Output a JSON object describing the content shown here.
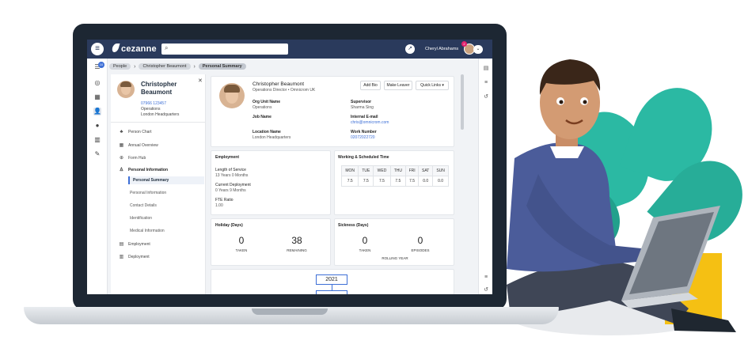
{
  "app": {
    "brand": "cezanne",
    "user_name": "Cheryl Abrahams",
    "user_badge": "2",
    "menu_icon": "hamburger-icon"
  },
  "search": {
    "placeholder": ""
  },
  "rail": {
    "badge": "10"
  },
  "breadcrumb": [
    "People",
    "Christopher Beaumont",
    "Personal Summary"
  ],
  "person": {
    "name": "Christopher Beaumont",
    "phone": "07966 123457",
    "department": "Operations",
    "location": "London Headquarters"
  },
  "nav": {
    "person_chart": "Person Chart",
    "annual_overview": "Annual Overview",
    "form_hub": "Form Hub",
    "personal_information": "Personal Information",
    "sub": [
      "Personal Summary",
      "Personal Information",
      "Contact Details",
      "Identification",
      "Medical Information"
    ],
    "employment": "Employment",
    "deployment": "Deployment"
  },
  "summary": {
    "name": "Christopher Beaumont",
    "title": "Operations Director • Omnicrom UK",
    "buttons": [
      "Add Bio",
      "Make Leaver",
      "Quick Links ▾"
    ],
    "org_unit_label": "Org Unit Name",
    "org_unit": "Operations",
    "supervisor_label": "Supervisor",
    "supervisor": "Sharma Sing",
    "job_label": "Job Name",
    "email_label": "Internal E-mail",
    "email": "chris@omnicrom.com",
    "location_label": "Location Name",
    "location": "London Headquarters",
    "work_label": "Work Number",
    "work": "02072022720"
  },
  "employment": {
    "title": "Employment",
    "los_label": "Length of Service",
    "los": "13 Years 0 Months",
    "cd_label": "Current Deployment",
    "cd": "0 Years 9 Months",
    "fte_label": "FTE Ratio",
    "fte": "1.00"
  },
  "working_time": {
    "title": "Working & Scheduled Time",
    "days": [
      "MON",
      "TUE",
      "WED",
      "THU",
      "FRI",
      "SAT",
      "SUN"
    ],
    "hours": [
      "7.5",
      "7.5",
      "7.5",
      "7.5",
      "7.5",
      "0.0",
      "0.0"
    ]
  },
  "holiday": {
    "title": "Holiday (Days)",
    "taken": "0",
    "taken_label": "TAKEN",
    "remaining": "38",
    "remaining_label": "REMAINING"
  },
  "sickness": {
    "title": "Sickness (Days)",
    "taken": "0",
    "taken_label": "TAKEN",
    "episodes": "0",
    "episodes_label": "EPISODES",
    "footer": "ROLLING YEAR"
  },
  "timeline": {
    "year": "2021"
  }
}
